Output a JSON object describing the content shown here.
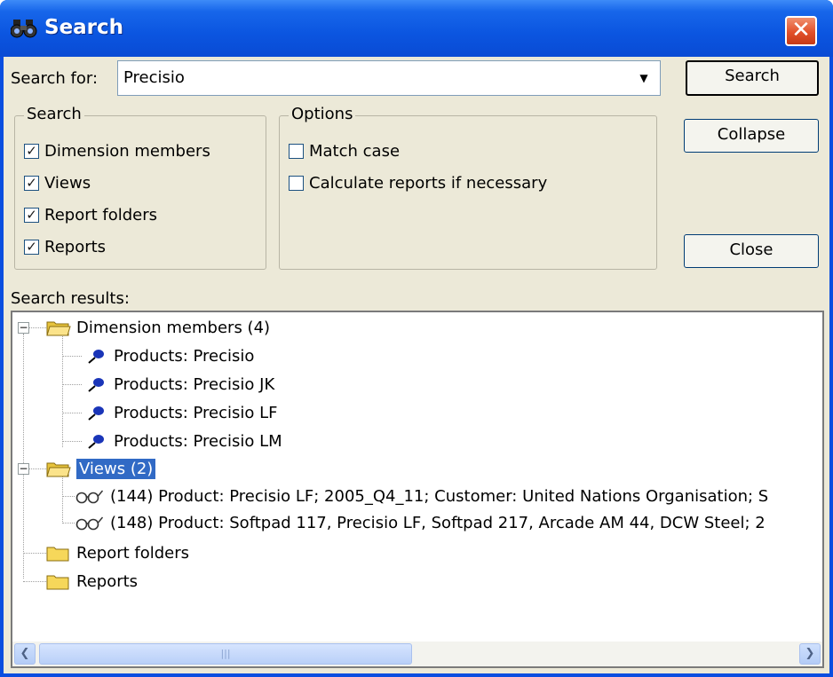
{
  "window": {
    "title": "Search",
    "close_glyph": "✕"
  },
  "search": {
    "label": "Search for:",
    "value": "Precisio",
    "dropdown_glyph": "▼"
  },
  "search_group": {
    "title": "Search",
    "items": [
      {
        "label": "Dimension members",
        "checked": true
      },
      {
        "label": "Views",
        "checked": true
      },
      {
        "label": "Report folders",
        "checked": true
      },
      {
        "label": "Reports",
        "checked": true
      }
    ]
  },
  "options_group": {
    "title": "Options",
    "items": [
      {
        "label": "Match case",
        "checked": false
      },
      {
        "label": "Calculate reports if necessary",
        "checked": false
      }
    ]
  },
  "buttons": {
    "search": "Search",
    "collapse": "Collapse",
    "close": "Close"
  },
  "results": {
    "label": "Search results:",
    "dimension_members": {
      "label": "Dimension members (4)",
      "items": [
        "Products: Precisio",
        "Products: Precisio JK",
        "Products: Precisio LF",
        "Products: Precisio LM"
      ]
    },
    "views": {
      "label": "Views (2)",
      "items": [
        "(144) Product: Precisio LF; 2005_Q4_11; Customer: United Nations Organisation; S",
        "(148) Product: Softpad 117, Precisio LF, Softpad 217, Arcade AM 44, DCW Steel; 2"
      ]
    },
    "report_folders": {
      "label": "Report folders"
    },
    "reports": {
      "label": "Reports"
    }
  },
  "icons": {
    "title": "binoculars-icon",
    "folder": "open-folder-icon",
    "member": "pushpin-icon",
    "view": "glasses-icon"
  },
  "colors": {
    "titlebar": "#0b55e0",
    "selection": "#316ac5",
    "dialog": "#ece9d8"
  }
}
